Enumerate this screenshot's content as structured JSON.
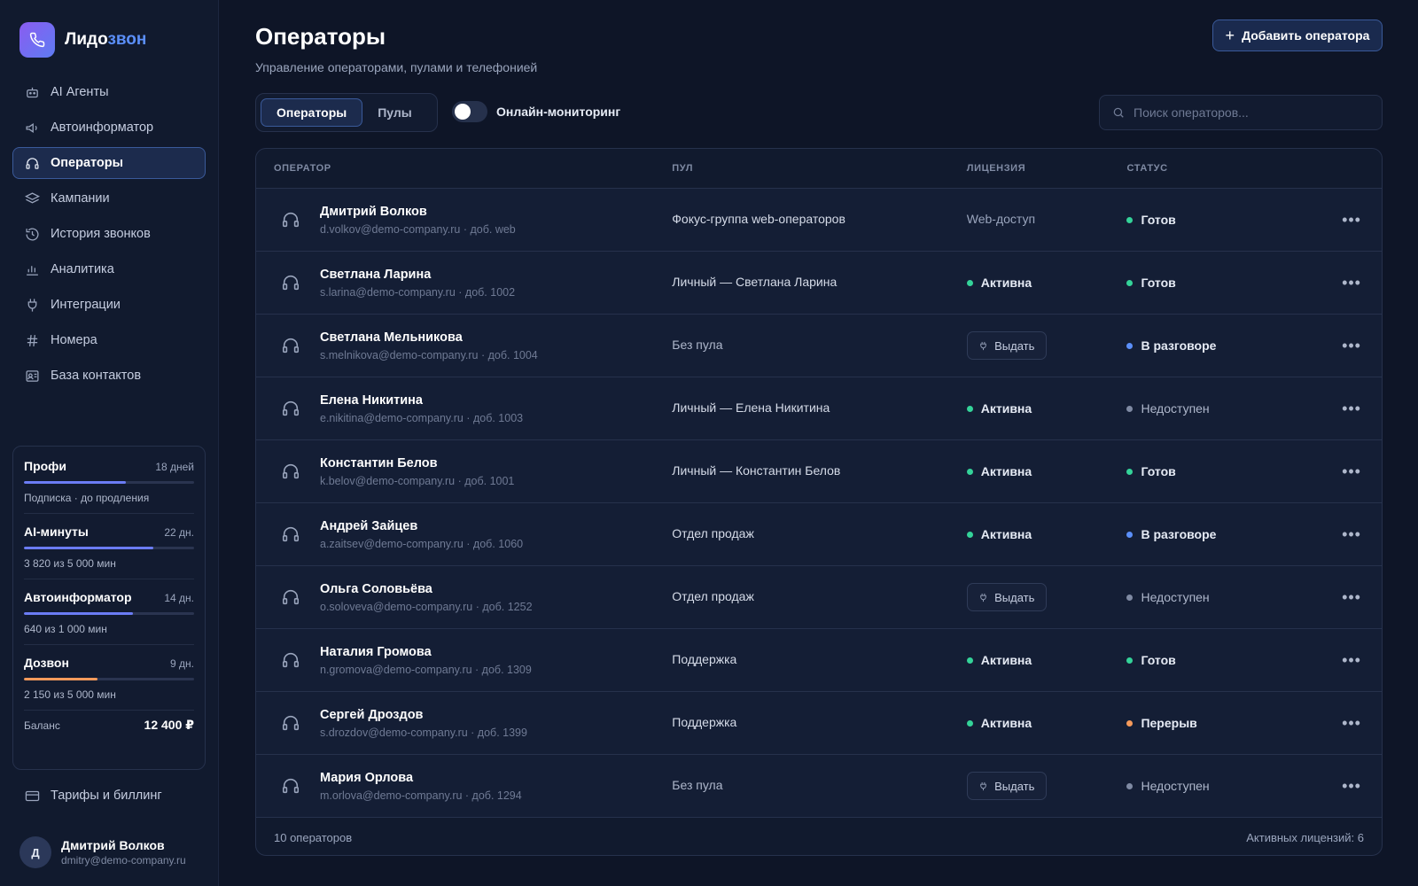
{
  "brand": {
    "name_part1": "Лидо",
    "name_part2": "звон"
  },
  "sidebar": {
    "items": [
      {
        "label": "AI Агенты",
        "icon": "robot-icon"
      },
      {
        "label": "Автоинформатор",
        "icon": "megaphone-icon"
      },
      {
        "label": "Операторы",
        "icon": "headset-icon",
        "active": true
      },
      {
        "label": "Кампании",
        "icon": "layers-icon"
      },
      {
        "label": "История звонков",
        "icon": "history-icon"
      },
      {
        "label": "Аналитика",
        "icon": "chart-icon"
      },
      {
        "label": "Интеграции",
        "icon": "plug-icon"
      },
      {
        "label": "Номера",
        "icon": "hash-icon"
      },
      {
        "label": "База контактов",
        "icon": "contacts-icon"
      }
    ],
    "billing_label": "Тарифы и биллинг"
  },
  "usage": {
    "plan": {
      "name": "Профи",
      "days": "18 дней",
      "sub": "Подписка · до продления",
      "progress": 0.6,
      "color": "#6b7cf5"
    },
    "ai_minutes": {
      "name": "AI-минуты",
      "days": "22 дн.",
      "sub": "3 820 из 5 000 мин",
      "progress": 0.76,
      "color": "#6b7cf5"
    },
    "autoinformer": {
      "name": "Автоинформатор",
      "days": "14 дн.",
      "sub": "640 из 1 000 мин",
      "progress": 0.64,
      "color": "#6b7cf5"
    },
    "dialer": {
      "name": "Дозвон",
      "days": "9 дн.",
      "sub": "2 150 из 5 000 мин",
      "progress": 0.43,
      "color": "#f59a5b"
    },
    "balance_label": "Баланс",
    "balance_value": "12 400 ₽"
  },
  "user": {
    "initial": "Д",
    "name": "Дмитрий Волков",
    "email": "dmitry@demo-company.ru"
  },
  "page": {
    "title": "Операторы",
    "subtitle": "Управление операторами, пулами и телефонией",
    "add_button": "Добавить оператора",
    "tabs": [
      "Операторы",
      "Пулы"
    ],
    "toggle_label": "Онлайн-мониторинг",
    "search_placeholder": "Поиск операторов..."
  },
  "table": {
    "headers": {
      "operator": "ОПЕРАТОР",
      "pool": "ПУЛ",
      "license": "ЛИЦЕНЗИЯ",
      "status": "СТАТУС"
    },
    "issue_label": "Выдать",
    "rows": [
      {
        "name": "Дмитрий Волков",
        "meta": "d.volkov@demo-company.ru · доб. web",
        "pool": "Фокус-группа web-операторов",
        "license_type": "text",
        "license": "Web-доступ",
        "status": "Готов",
        "status_color": "#34d399"
      },
      {
        "name": "Светлана Ларина",
        "meta": "s.larina@demo-company.ru · доб. 1002",
        "pool": "Личный — Светлана Ларина",
        "license_type": "active",
        "license": "Активна",
        "status": "Готов",
        "status_color": "#34d399"
      },
      {
        "name": "Светлана Мельникова",
        "meta": "s.melnikova@demo-company.ru · доб. 1004",
        "pool": "Без пула",
        "pool_muted": true,
        "license_type": "issue",
        "license": "Выдать",
        "status": "В разговоре",
        "status_color": "#5b8ff9"
      },
      {
        "name": "Елена Никитина",
        "meta": "e.nikitina@demo-company.ru · доб. 1003",
        "pool": "Личный — Елена Никитина",
        "license_type": "active",
        "license": "Активна",
        "status": "Недоступен",
        "status_color": "#7f8aa3",
        "status_muted": true
      },
      {
        "name": "Константин Белов",
        "meta": "k.belov@demo-company.ru · доб. 1001",
        "pool": "Личный — Константин Белов",
        "license_type": "active",
        "license": "Активна",
        "status": "Готов",
        "status_color": "#34d399"
      },
      {
        "name": "Андрей Зайцев",
        "meta": "a.zaitsev@demo-company.ru · доб. 1060",
        "pool": "Отдел продаж",
        "license_type": "active",
        "license": "Активна",
        "status": "В разговоре",
        "status_color": "#5b8ff9"
      },
      {
        "name": "Ольга Соловьёва",
        "meta": "o.soloveva@demo-company.ru · доб. 1252",
        "pool": "Отдел продаж",
        "license_type": "issue",
        "license": "Выдать",
        "status": "Недоступен",
        "status_color": "#7f8aa3",
        "status_muted": true
      },
      {
        "name": "Наталия Громова",
        "meta": "n.gromova@demo-company.ru · доб. 1309",
        "pool": "Поддержка",
        "license_type": "active",
        "license": "Активна",
        "status": "Готов",
        "status_color": "#34d399"
      },
      {
        "name": "Сергей Дроздов",
        "meta": "s.drozdov@demo-company.ru · доб. 1399",
        "pool": "Поддержка",
        "license_type": "active",
        "license": "Активна",
        "status": "Перерыв",
        "status_color": "#f59a5b"
      },
      {
        "name": "Мария Орлова",
        "meta": "m.orlova@demo-company.ru · доб. 1294",
        "pool": "Без пула",
        "pool_muted": true,
        "license_type": "issue",
        "license": "Выдать",
        "status": "Недоступен",
        "status_color": "#7f8aa3",
        "status_muted": true
      }
    ],
    "footer_count": "10 операторов",
    "footer_licenses": "Активных лицензий: 6"
  },
  "colors": {
    "active_dot": "#34d399",
    "accent": "#5b8ff9"
  }
}
